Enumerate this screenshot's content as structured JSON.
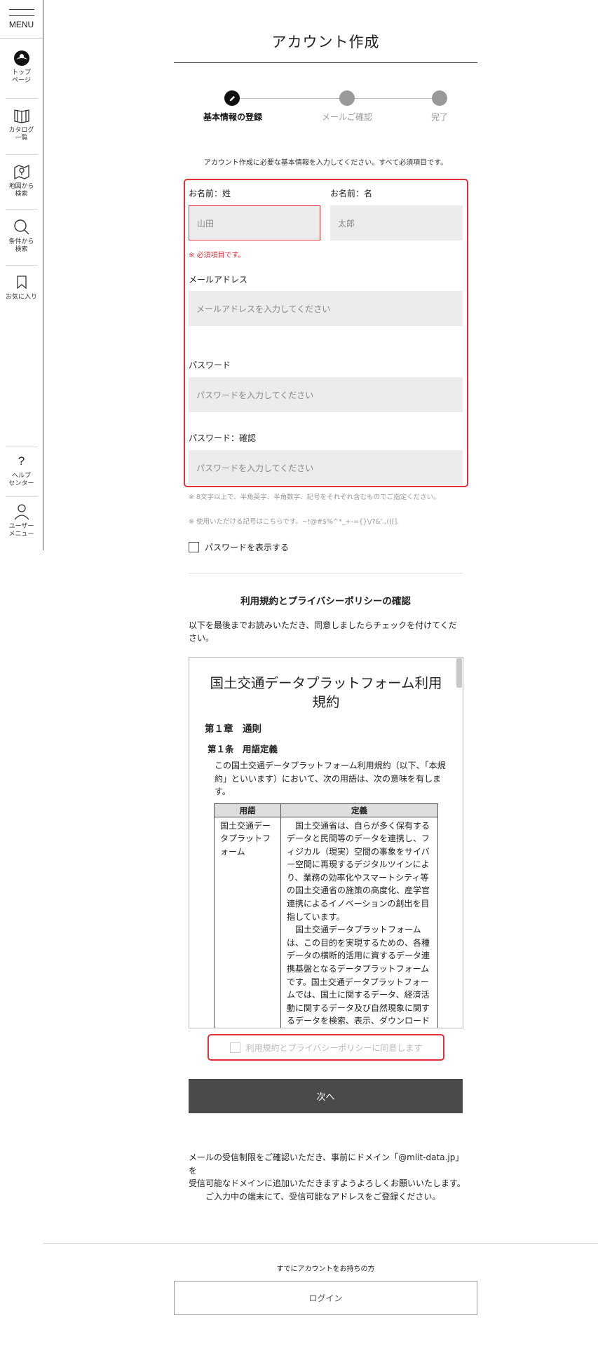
{
  "sidebar": {
    "menu_label": "MENU",
    "items": [
      {
        "label": "トップ\nページ",
        "icon": "logo-icon"
      },
      {
        "label": "カタログ\n一覧",
        "icon": "book-icon"
      },
      {
        "label": "地図から\n検索",
        "icon": "map-icon"
      },
      {
        "label": "条件から\n検索",
        "icon": "search-icon"
      },
      {
        "label": "お気に入り",
        "icon": "bookmark-icon"
      }
    ],
    "bottom_items": [
      {
        "label": "ヘルプ\nセンター",
        "icon": "help-icon"
      },
      {
        "label": "ユーザー\nメニュー",
        "icon": "user-icon"
      }
    ]
  },
  "page": {
    "title": "アカウント作成",
    "steps": [
      {
        "label": "基本情報の登録",
        "active": true
      },
      {
        "label": "メールご確認",
        "active": false
      },
      {
        "label": "完了",
        "active": false
      }
    ],
    "intro": "アカウント作成に必要な基本情報を入力してください。すべて必須項目です。"
  },
  "form": {
    "last_name_label": "お名前：姓",
    "last_name_placeholder": "山田",
    "first_name_label": "お名前：名",
    "first_name_placeholder": "太郎",
    "required_error": "※ 必須項目です。",
    "email_label": "メールアドレス",
    "email_placeholder": "メールアドレスを入力してください",
    "password_label": "パスワード",
    "password_placeholder": "パスワードを入力してください",
    "password_confirm_label": "パスワード：確認",
    "password_confirm_placeholder": "パスワードを入力してください",
    "password_note_1": "※ 8文字以上で、半角英字、半角数字、記号をそれぞれ含むものでご指定ください。",
    "password_note_2": "※ 使用いただける記号はこちらです。~!@#$%^*_+-={}\\/?&'.,()[].",
    "show_password_label": "パスワードを表示する"
  },
  "terms": {
    "section_title": "利用規約とプライバシーポリシーの確認",
    "section_intro": "以下を最後までお読みいただき、同意しましたらチェックを付けてください。",
    "heading": "国土交通データプラットフォーム利用規約",
    "chapter": "第１章　通則",
    "article": "第１条　用語定義",
    "paragraph": "この国土交通データプラットフォーム利用規約（以下、「本規約」といいます）において、次の用語は、次の意味を有します。",
    "table_headers": [
      "用語",
      "定義"
    ],
    "table_term": "国土交通データプラットフォーム",
    "table_def_1": "　国土交通省は、自らが多く保有するデータと民間等のデータを連携し、フィジカル（現実）空間の事象をサイバー空間に再現するデジタルツインにより、業務の効率化やスマートシティ等の国土交通省の施策の高度化、産学官連携によるイノベーションの創出を目指しています。",
    "table_def_2": "　国土交通データプラットフォームは、この目的を実現するための、各種データの横断的活用に資するデータ連携基盤となるデータプラットフォームです。国土交通データプラットフォームでは、国土に関するデータ、経済活動に関するデータ及び自然現象に関するデータを検索、表示、ダウンロードできることを目指します。",
    "agree_label": "利用規約とプライバシーポリシーに同意します"
  },
  "actions": {
    "next_label": "次へ"
  },
  "mail_note": "メールの受信制限をご確認いただき、事前にドメイン「@mlit-data.jp」を\n受信可能なドメインに追加いただきますようよろしくお願いいたします。\n　　ご入力中の端末にて、受信可能なアドレスをご登録ください。",
  "footer": {
    "have_account": "すでにアカウントをお持ちの方",
    "login_label": "ログイン"
  },
  "colors": {
    "error": "#e2303a",
    "button_dark": "#4a4a4a",
    "input_bg": "#ececec"
  }
}
